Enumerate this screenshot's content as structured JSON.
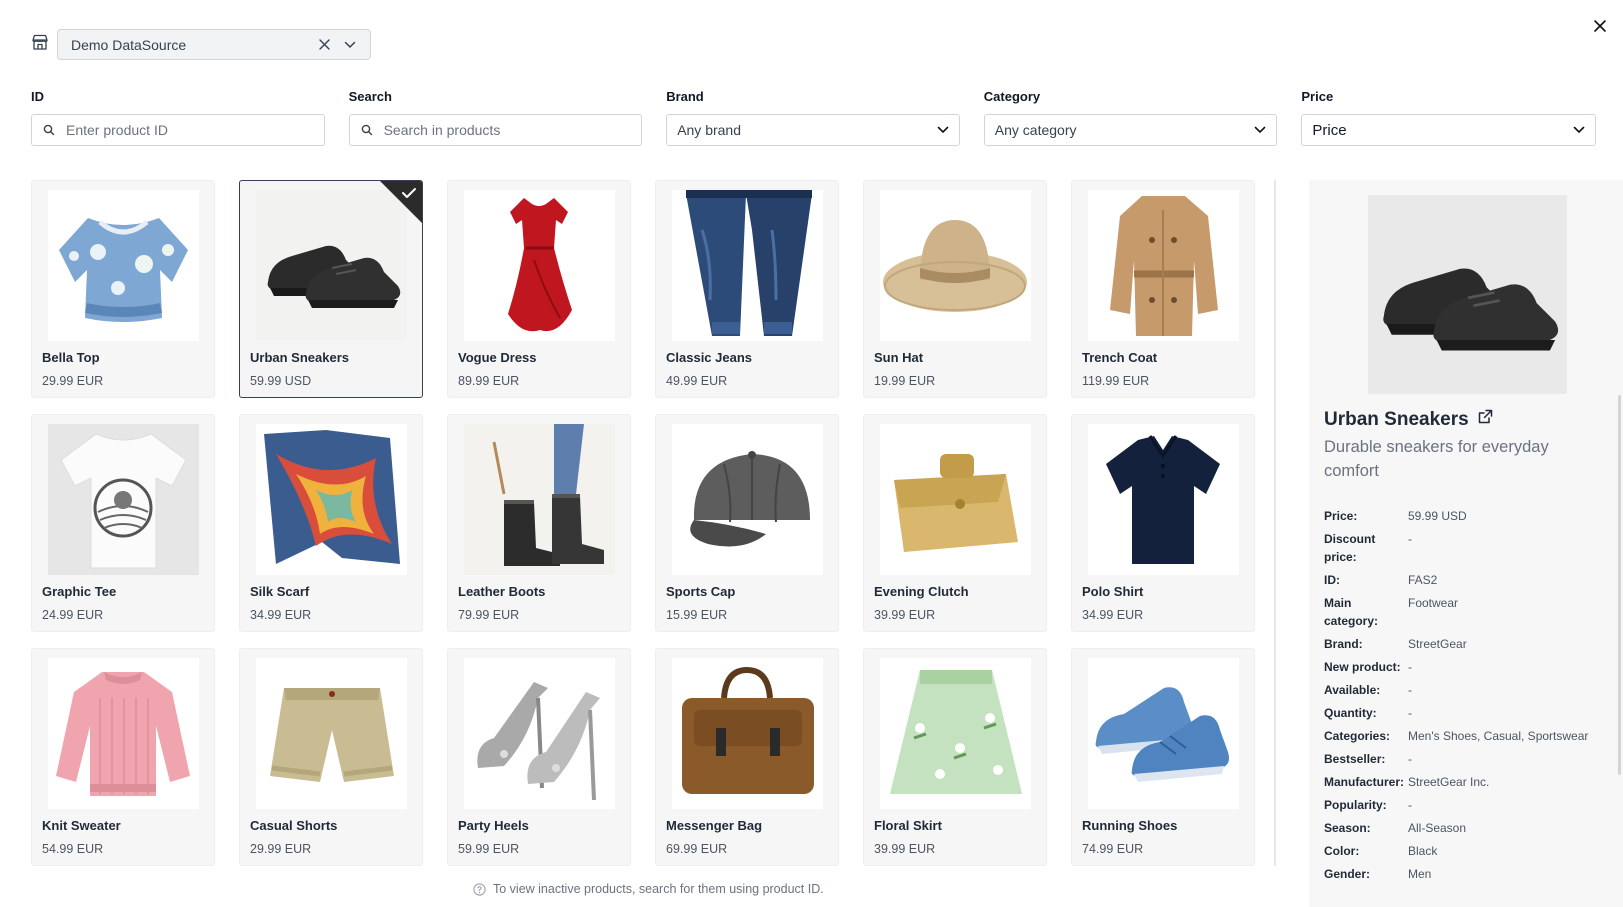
{
  "datasource": {
    "value": "Demo DataSource"
  },
  "filters": {
    "id": {
      "label": "ID",
      "placeholder": "Enter product ID"
    },
    "search": {
      "label": "Search",
      "placeholder": "Search in products"
    },
    "brand": {
      "label": "Brand",
      "value": "Any brand"
    },
    "category": {
      "label": "Category",
      "value": "Any category"
    },
    "price": {
      "label": "Price",
      "value": "Price"
    }
  },
  "products": [
    {
      "name": "Bella Top",
      "price": "29.99 EUR",
      "image": "blouse"
    },
    {
      "name": "Urban Sneakers",
      "price": "59.99 USD",
      "image": "sneakers",
      "selected": true
    },
    {
      "name": "Vogue Dress",
      "price": "89.99 EUR",
      "image": "dress"
    },
    {
      "name": "Classic Jeans",
      "price": "49.99 EUR",
      "image": "jeans"
    },
    {
      "name": "Sun Hat",
      "price": "19.99 EUR",
      "image": "hat"
    },
    {
      "name": "Trench Coat",
      "price": "119.99 EUR",
      "image": "coat"
    },
    {
      "name": "Graphic Tee",
      "price": "24.99 EUR",
      "image": "tshirt"
    },
    {
      "name": "Silk Scarf",
      "price": "34.99 EUR",
      "image": "scarf"
    },
    {
      "name": "Leather Boots",
      "price": "79.99 EUR",
      "image": "boots"
    },
    {
      "name": "Sports Cap",
      "price": "15.99 EUR",
      "image": "cap"
    },
    {
      "name": "Evening Clutch",
      "price": "39.99 EUR",
      "image": "clutch"
    },
    {
      "name": "Polo Shirt",
      "price": "34.99 EUR",
      "image": "polo"
    },
    {
      "name": "Knit Sweater",
      "price": "54.99 EUR",
      "image": "sweater"
    },
    {
      "name": "Casual Shorts",
      "price": "29.99 EUR",
      "image": "shorts"
    },
    {
      "name": "Party Heels",
      "price": "59.99 EUR",
      "image": "heels"
    },
    {
      "name": "Messenger Bag",
      "price": "69.99 EUR",
      "image": "bag"
    },
    {
      "name": "Floral Skirt",
      "price": "39.99 EUR",
      "image": "skirt"
    },
    {
      "name": "Running Shoes",
      "price": "74.99 EUR",
      "image": "runners"
    }
  ],
  "hint": "To view inactive products, search for them using product ID.",
  "detail": {
    "title": "Urban Sneakers",
    "description": "Durable sneakers for everyday comfort",
    "properties": [
      {
        "key": "Price:",
        "value": "59.99 USD"
      },
      {
        "key": "Discount price:",
        "value": "-"
      },
      {
        "key": "ID:",
        "value": "FAS2"
      },
      {
        "key": "Main category:",
        "value": "Footwear"
      },
      {
        "key": "Brand:",
        "value": "StreetGear"
      },
      {
        "key": "New product:",
        "value": "-"
      },
      {
        "key": "Available:",
        "value": "-"
      },
      {
        "key": "Quantity:",
        "value": "-"
      },
      {
        "key": "Categories:",
        "value": "Men's Shoes, Casual, Sportswear"
      },
      {
        "key": "Bestseller:",
        "value": "-"
      },
      {
        "key": "Manufacturer:",
        "value": "StreetGear Inc."
      },
      {
        "key": "Popularity:",
        "value": "-"
      },
      {
        "key": "Season:",
        "value": "All-Season"
      },
      {
        "key": "Color:",
        "value": "Black"
      },
      {
        "key": "Gender:",
        "value": "Men"
      }
    ]
  },
  "colors": {
    "card_bg": "#f6f6f6",
    "selected_border": "#374151",
    "text": "#1f2937",
    "muted": "#6b7280"
  }
}
